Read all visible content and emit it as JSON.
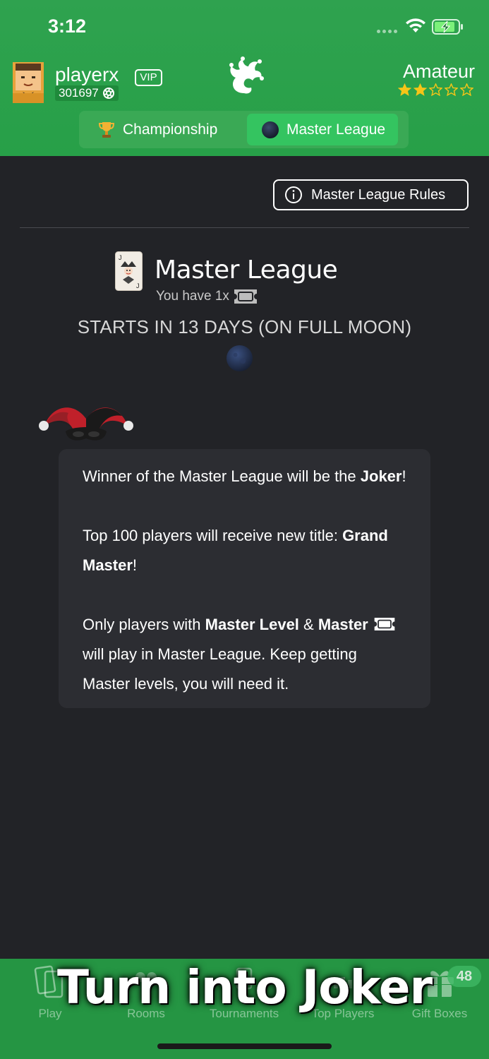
{
  "status_bar": {
    "time": "3:12"
  },
  "header": {
    "username": "playerx",
    "vip_label": "VIP",
    "coins": "301697",
    "rank_title": "Amateur",
    "rank_stars": {
      "filled": 2,
      "total": 5
    }
  },
  "league_tabs": [
    {
      "label": "Championship",
      "icon": "trophy-icon",
      "selected": false
    },
    {
      "label": "Master League",
      "icon": "moon-icon",
      "selected": true
    }
  ],
  "main": {
    "rules_button_label": "Master League Rules",
    "league_title": "Master League",
    "you_have_text": "You have 1x",
    "starts_text": "STARTS IN 13 DAYS (ON FULL MOON)",
    "info": {
      "p1_prefix": "Winner of the Master League will be the ",
      "p1_bold": "Joker",
      "p1_suffix": "!",
      "p2_prefix": "Top 100 players will receive new title: ",
      "p2_bold": "Grand Master",
      "p2_suffix": "!",
      "p3_prefix": "Only players with ",
      "p3_bold1": "Master Level",
      "p3_amp": " & ",
      "p3_bold2": "Master",
      "p3_suffix": " will play in Master League. Keep getting Master levels, you will need it."
    }
  },
  "bottom_nav": [
    {
      "label": "Play",
      "icon": "cards-icon"
    },
    {
      "label": "Rooms",
      "icon": "rooms-icon"
    },
    {
      "label": "Tournaments",
      "icon": "tournaments-icon"
    },
    {
      "label": "Top Players",
      "icon": "top-players-icon"
    },
    {
      "label": "Gift Boxes",
      "icon": "gift-icon"
    }
  ],
  "gift_badge": "48",
  "overlay_caption": "Turn into Joker",
  "colors": {
    "header_green": "#2fa24f",
    "background": "#222327",
    "info_box": "#2c2d32",
    "star_gold": "#f5c518"
  }
}
